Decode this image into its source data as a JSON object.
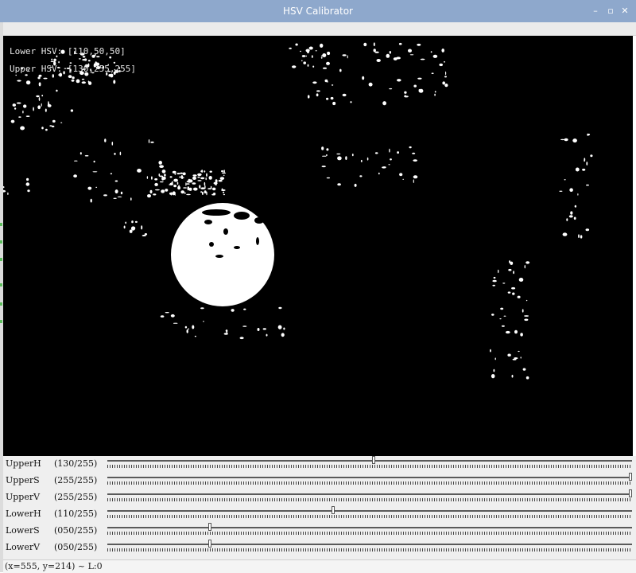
{
  "window": {
    "title": "HSV Calibrator",
    "minimize_glyph": "–",
    "maximize_glyph": "▫",
    "close_glyph": "✕"
  },
  "overlay": {
    "lower_text": "Lower HSV: [110,50,50]",
    "upper_text": "Upper HSV: [130,255,255]"
  },
  "trackbars": [
    {
      "name": "UpperH",
      "value_text": "(130/255)",
      "value": 130,
      "max": 255
    },
    {
      "name": "UpperS",
      "value_text": "(255/255)",
      "value": 255,
      "max": 255
    },
    {
      "name": "UpperV",
      "value_text": "(255/255)",
      "value": 255,
      "max": 255
    },
    {
      "name": "LowerH",
      "value_text": "(110/255)",
      "value": 110,
      "max": 255
    },
    {
      "name": "LowerS",
      "value_text": "(050/255)",
      "value": 50,
      "max": 255
    },
    {
      "name": "LowerV",
      "value_text": "(050/255)",
      "value": 50,
      "max": 255
    }
  ],
  "status": {
    "text": "(x=555, y=214) ~ L:0"
  },
  "colors": {
    "titlebar": "#8ea8cc",
    "mask_background": "#000000",
    "mask_foreground": "#ffffff"
  }
}
